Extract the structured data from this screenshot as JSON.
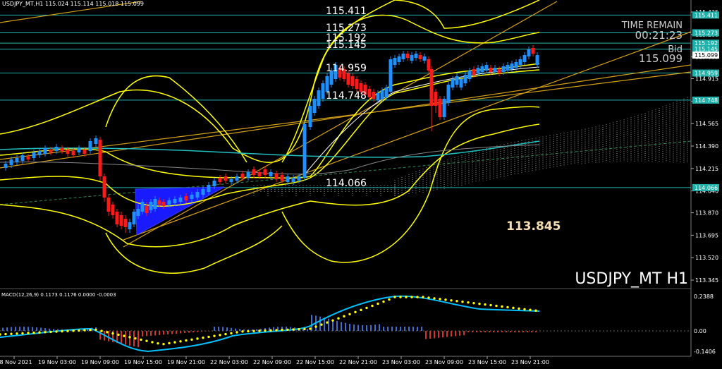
{
  "header": {
    "symbol_info": "USDJPY_MT,H1",
    "ohlc": "115.024 115.114 115.018 115.099"
  },
  "overlay": {
    "time_remain_label": "TIME REMAIN",
    "time_remain_value": "00:21:23",
    "bid_label": "Bid",
    "bid_value": "115.099",
    "instrument_title": "USDJPY_MT H1",
    "target_label": "113.845"
  },
  "level_labels": [
    "115.411",
    "115.273",
    "115.192",
    "115.145",
    "114.959",
    "114.748",
    "114.066"
  ],
  "main_axis": {
    "ticks": [
      "115.435",
      "115.260",
      "115.085",
      "114.915",
      "114.740",
      "114.565",
      "114.390",
      "114.215",
      "114.040",
      "113.870",
      "113.695",
      "113.520",
      "113.345"
    ],
    "level_tags": [
      "115.411",
      "115.273",
      "115.192",
      "115.145",
      "115.099",
      "114.959",
      "114.748",
      "114.066"
    ]
  },
  "macd": {
    "label": "MACD(12,26,9) 0.1173 0.1176 0.0000 -0.0003",
    "ticks": [
      "0.2388",
      "0.00",
      "-0.1406"
    ]
  },
  "time_axis": [
    "18 Nov 2021",
    "19 Nov 03:00",
    "19 Nov 09:00",
    "19 Nov 15:00",
    "19 Nov 21:00",
    "22 Nov 03:00",
    "22 Nov 09:00",
    "22 Nov 15:00",
    "22 Nov 21:00",
    "23 Nov 03:00",
    "23 Nov 09:00",
    "23 Nov 15:00",
    "23 Nov 21:00"
  ],
  "colors": {
    "background": "#000000",
    "bull": "#1e90ff",
    "bear": "#ff1a1a",
    "bollinger": "#ffff00",
    "trendline": "#d4a017",
    "level": "#20b2aa",
    "macd_line": "#00bfff",
    "signal": "#ffff00",
    "ichimoku_cloud": "#9a9a9a",
    "triangle": "#1a1aff"
  },
  "chart_data": {
    "type": "candlestick",
    "title": "USDJPY_MT H1",
    "ylim": [
      113.3,
      115.49
    ],
    "x": [
      "18 Nov 2021",
      "19 Nov 03:00",
      "19 Nov 09:00",
      "19 Nov 15:00",
      "19 Nov 21:00",
      "22 Nov 03:00",
      "22 Nov 09:00",
      "22 Nov 15:00",
      "22 Nov 21:00",
      "23 Nov 03:00",
      "23 Nov 09:00",
      "23 Nov 15:00",
      "23 Nov 21:00"
    ],
    "levels": [
      115.411,
      115.273,
      115.192,
      115.145,
      114.959,
      114.748,
      114.066
    ],
    "last_price": 115.099,
    "annotation": 113.845,
    "macd_ylim": [
      -0.1406,
      0.2388
    ]
  }
}
